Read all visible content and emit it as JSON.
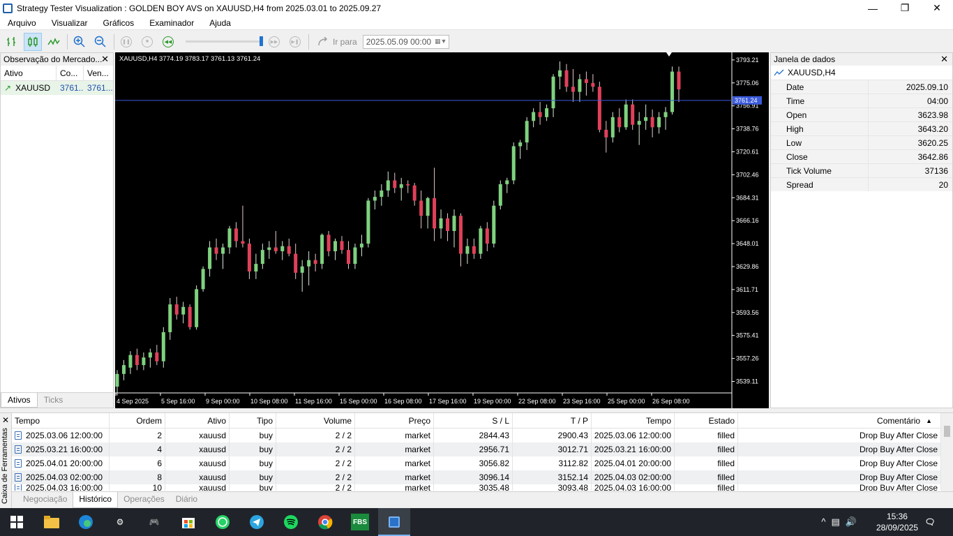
{
  "window": {
    "title": "Strategy Tester Visualization : GOLDEN BOY AVS on XAUUSD,H4 from 2025.03.01 to 2025.09.27"
  },
  "menu": [
    "Arquivo",
    "Visualizar",
    "Gráficos",
    "Examinador",
    "Ajuda"
  ],
  "toolbar": {
    "goto_label": "Ir para",
    "goto_date": "2025.05.09 00:00",
    "speed_fraction": 0.98
  },
  "market_watch": {
    "title": "Observação do Mercado...",
    "columns": [
      "Ativo",
      "Co...",
      "Ven..."
    ],
    "rows": [
      {
        "symbol": "XAUUSD",
        "bid": "3761...",
        "ask": "3761..."
      }
    ],
    "tabs": [
      "Ativos",
      "Ticks"
    ]
  },
  "chart": {
    "header": "XAUUSD,H4  3774.19 3783.17 3761.13 3761.24",
    "current_price_label": "3761.24",
    "current_price": 3761.24,
    "price_axis": [
      "3793.21",
      "3775.06",
      "3756.91",
      "3738.76",
      "3720.61",
      "3702.46",
      "3684.31",
      "3666.16",
      "3648.01",
      "3629.86",
      "3611.71",
      "3593.56",
      "3575.41",
      "3557.26",
      "3539.11"
    ],
    "time_axis": [
      "4 Sep 2025",
      "5 Sep 16:00",
      "9 Sep 00:00",
      "10 Sep 08:00",
      "11 Sep 16:00",
      "15 Sep 00:00",
      "16 Sep 08:00",
      "17 Sep 16:00",
      "19 Sep 00:00",
      "22 Sep 08:00",
      "23 Sep 16:00",
      "25 Sep 00:00",
      "26 Sep 08:00"
    ],
    "colors": {
      "up": "#7fd17f",
      "down": "#e0405a",
      "bg": "#000000",
      "price_line": "#3b5bdb"
    }
  },
  "chart_data": {
    "type": "candlestick",
    "symbol": "XAUUSD",
    "timeframe": "H4",
    "ylim": [
      3530,
      3797
    ],
    "candles": [
      [
        3535,
        3548,
        3528,
        3545
      ],
      [
        3545,
        3556,
        3540,
        3552
      ],
      [
        3550,
        3563,
        3545,
        3560
      ],
      [
        3560,
        3565,
        3548,
        3552
      ],
      [
        3552,
        3562,
        3548,
        3558
      ],
      [
        3558,
        3565,
        3550,
        3562
      ],
      [
        3562,
        3568,
        3552,
        3555
      ],
      [
        3555,
        3582,
        3550,
        3578
      ],
      [
        3578,
        3605,
        3572,
        3600
      ],
      [
        3600,
        3606,
        3588,
        3592
      ],
      [
        3592,
        3602,
        3585,
        3598
      ],
      [
        3598,
        3600,
        3580,
        3582
      ],
      [
        3582,
        3615,
        3580,
        3612
      ],
      [
        3612,
        3630,
        3610,
        3628
      ],
      [
        3628,
        3650,
        3622,
        3645
      ],
      [
        3645,
        3652,
        3635,
        3640
      ],
      [
        3640,
        3648,
        3628,
        3645
      ],
      [
        3645,
        3662,
        3640,
        3660
      ],
      [
        3660,
        3665,
        3645,
        3650
      ],
      [
        3650,
        3678,
        3645,
        3648
      ],
      [
        3648,
        3652,
        3620,
        3626
      ],
      [
        3626,
        3640,
        3620,
        3632
      ],
      [
        3632,
        3648,
        3628,
        3643
      ],
      [
        3643,
        3650,
        3636,
        3645
      ],
      [
        3645,
        3658,
        3640,
        3642
      ],
      [
        3642,
        3650,
        3635,
        3646
      ],
      [
        3646,
        3652,
        3638,
        3640
      ],
      [
        3640,
        3648,
        3620,
        3625
      ],
      [
        3625,
        3635,
        3610,
        3630
      ],
      [
        3630,
        3642,
        3615,
        3635
      ],
      [
        3635,
        3640,
        3626,
        3632
      ],
      [
        3632,
        3656,
        3628,
        3655
      ],
      [
        3655,
        3658,
        3638,
        3642
      ],
      [
        3642,
        3652,
        3635,
        3650
      ],
      [
        3650,
        3654,
        3640,
        3643
      ],
      [
        3643,
        3650,
        3628,
        3632
      ],
      [
        3632,
        3648,
        3628,
        3645
      ],
      [
        3645,
        3655,
        3638,
        3648
      ],
      [
        3648,
        3684,
        3645,
        3682
      ],
      [
        3682,
        3690,
        3675,
        3685
      ],
      [
        3685,
        3695,
        3678,
        3690
      ],
      [
        3690,
        3705,
        3685,
        3698
      ],
      [
        3698,
        3704,
        3688,
        3692
      ],
      [
        3692,
        3700,
        3682,
        3695
      ],
      [
        3695,
        3698,
        3688,
        3694
      ],
      [
        3694,
        3696,
        3678,
        3682
      ],
      [
        3682,
        3690,
        3660,
        3670
      ],
      [
        3670,
        3685,
        3660,
        3684
      ],
      [
        3684,
        3708,
        3650,
        3660
      ],
      [
        3660,
        3675,
        3652,
        3668
      ],
      [
        3668,
        3672,
        3650,
        3658
      ],
      [
        3658,
        3675,
        3645,
        3670
      ],
      [
        3670,
        3672,
        3630,
        3640
      ],
      [
        3640,
        3652,
        3632,
        3646
      ],
      [
        3646,
        3652,
        3636,
        3640
      ],
      [
        3640,
        3662,
        3636,
        3660
      ],
      [
        3660,
        3665,
        3642,
        3648
      ],
      [
        3648,
        3682,
        3645,
        3678
      ],
      [
        3678,
        3698,
        3675,
        3695
      ],
      [
        3695,
        3700,
        3688,
        3698
      ],
      [
        3698,
        3728,
        3695,
        3725
      ],
      [
        3725,
        3730,
        3715,
        3728
      ],
      [
        3728,
        3748,
        3722,
        3745
      ],
      [
        3745,
        3755,
        3740,
        3752
      ],
      [
        3752,
        3760,
        3742,
        3748
      ],
      [
        3748,
        3758,
        3745,
        3755
      ],
      [
        3755,
        3782,
        3748,
        3780
      ],
      [
        3780,
        3792,
        3770,
        3785
      ],
      [
        3785,
        3790,
        3768,
        3772
      ],
      [
        3772,
        3786,
        3760,
        3768
      ],
      [
        3768,
        3782,
        3760,
        3778
      ],
      [
        3778,
        3784,
        3765,
        3775
      ],
      [
        3775,
        3782,
        3768,
        3772
      ],
      [
        3772,
        3776,
        3736,
        3738
      ],
      [
        3738,
        3745,
        3720,
        3732
      ],
      [
        3732,
        3752,
        3728,
        3748
      ],
      [
        3748,
        3755,
        3736,
        3740
      ],
      [
        3740,
        3762,
        3738,
        3758
      ],
      [
        3758,
        3762,
        3738,
        3742
      ],
      [
        3742,
        3752,
        3726,
        3745
      ],
      [
        3745,
        3758,
        3738,
        3748
      ],
      [
        3748,
        3754,
        3732,
        3740
      ],
      [
        3740,
        3752,
        3735,
        3748
      ],
      [
        3748,
        3756,
        3738,
        3752
      ],
      [
        3752,
        3788,
        3750,
        3784
      ],
      [
        3784,
        3788,
        3760,
        3770
      ]
    ]
  },
  "data_window": {
    "title": "Janela de dados",
    "symbol": "XAUUSD,H4",
    "rows": [
      {
        "k": "Date",
        "v": "2025.09.10"
      },
      {
        "k": "Time",
        "v": "04:00"
      },
      {
        "k": "Open",
        "v": "3623.98"
      },
      {
        "k": "High",
        "v": "3643.20"
      },
      {
        "k": "Low",
        "v": "3620.25"
      },
      {
        "k": "Close",
        "v": "3642.86"
      },
      {
        "k": "Tick Volume",
        "v": "37136"
      },
      {
        "k": "Spread",
        "v": "20"
      }
    ]
  },
  "toolbox": {
    "side_label": "Caixa de Ferramentas",
    "columns": [
      "Tempo",
      "Ordem",
      "Ativo",
      "Tipo",
      "Volume",
      "Preço",
      "S / L",
      "T / P",
      "Tempo",
      "Estado",
      "Comentário"
    ],
    "rows": [
      [
        "2025.03.06 12:00:00",
        "2",
        "xauusd",
        "buy",
        "2 / 2",
        "market",
        "2844.43",
        "2900.43",
        "2025.03.06 12:00:00",
        "filled",
        "Drop Buy After Close"
      ],
      [
        "2025.03.21 16:00:00",
        "4",
        "xauusd",
        "buy",
        "2 / 2",
        "market",
        "2956.71",
        "3012.71",
        "2025.03.21 16:00:00",
        "filled",
        "Drop Buy After Close"
      ],
      [
        "2025.04.01 20:00:00",
        "6",
        "xauusd",
        "buy",
        "2 / 2",
        "market",
        "3056.82",
        "3112.82",
        "2025.04.01 20:00:00",
        "filled",
        "Drop Buy After Close"
      ],
      [
        "2025.04.03 02:00:00",
        "8",
        "xauusd",
        "buy",
        "2 / 2",
        "market",
        "3096.14",
        "3152.14",
        "2025.04.03 02:00:00",
        "filled",
        "Drop Buy After Close"
      ],
      [
        "2025.04.03 16:00:00",
        "10",
        "xauusd",
        "buy",
        "2 / 2",
        "market",
        "3035.48",
        "3093.48",
        "2025.04.03 16:00:00",
        "filled",
        "Drop Buy After Close"
      ]
    ],
    "tabs": [
      "Negociação",
      "Histórico",
      "Operações",
      "Diário"
    ]
  },
  "taskbar": {
    "time": "15:36",
    "date": "28/09/2025",
    "fbs_label": "FBS"
  }
}
